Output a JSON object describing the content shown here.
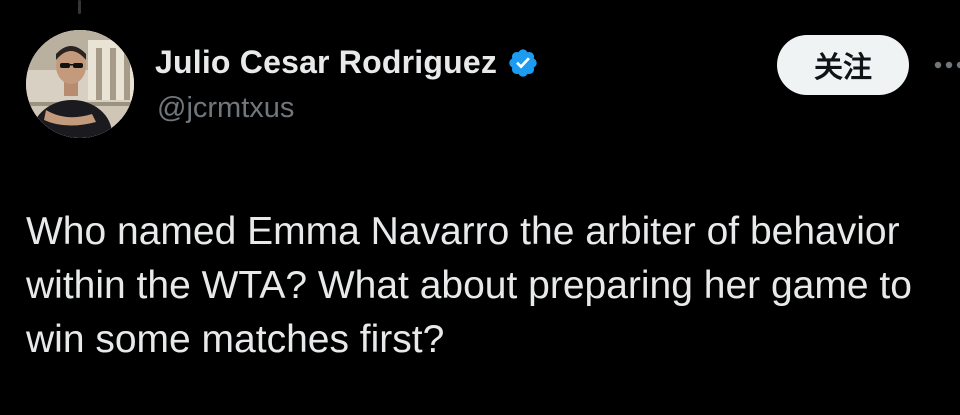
{
  "post": {
    "author": {
      "display_name": "Julio Cesar Rodriguez",
      "handle": "@jcrmtxus",
      "verified": true,
      "verified_icon": "verified-badge-icon",
      "avatar_icon": "profile-photo"
    },
    "follow_label": "关注",
    "more_icon": "more-options-icon",
    "text": "Who named Emma Navarro the arbiter of behavior within the WTA? What about preparing her game to win some matches first?"
  },
  "colors": {
    "background": "#000000",
    "text_primary": "#e7e9ea",
    "text_secondary": "#71767b",
    "verified_blue": "#1d9bf0",
    "follow_bg": "#eff3f4"
  }
}
